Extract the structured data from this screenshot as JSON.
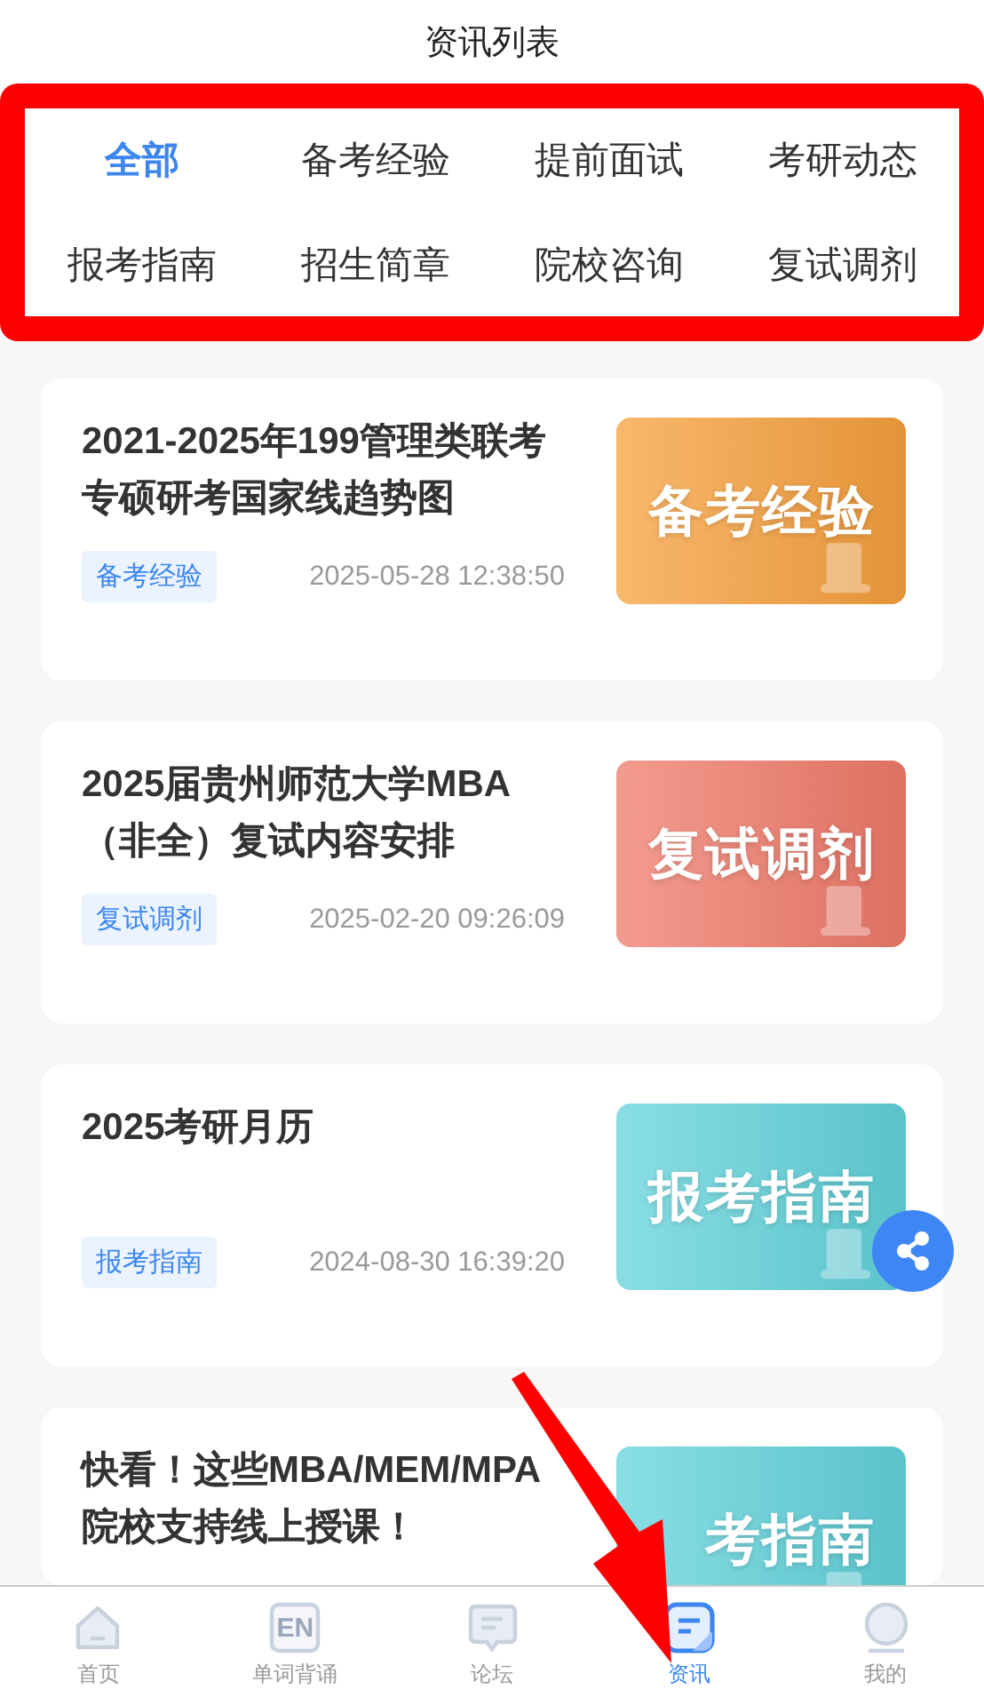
{
  "header": {
    "title": "资讯列表"
  },
  "categories": [
    {
      "label": "全部",
      "selected": true
    },
    {
      "label": "备考经验",
      "selected": false
    },
    {
      "label": "提前面试",
      "selected": false
    },
    {
      "label": "考研动态",
      "selected": false
    },
    {
      "label": "报考指南",
      "selected": false
    },
    {
      "label": "招生简章",
      "selected": false
    },
    {
      "label": "院校咨询",
      "selected": false
    },
    {
      "label": "复试调剂",
      "selected": false
    }
  ],
  "articles": [
    {
      "title": "2021-2025年199管理类联考专硕研考国家线趋势图",
      "tag": "备考经验",
      "date": "2025-05-28 12:38:50",
      "thumbnail": {
        "label": "备考经验",
        "color": "#f7a03c"
      }
    },
    {
      "title": "2025届贵州师范大学MBA（非全）复试内容安排",
      "tag": "复试调剂",
      "date": "2025-02-20 09:26:09",
      "thumbnail": {
        "label": "复试调剂",
        "color": "#f07a6a"
      }
    },
    {
      "title": "2025考研月历",
      "tag": "报考指南",
      "date": "2024-08-30 16:39:20",
      "thumbnail": {
        "label": "报考指南",
        "color": "#62d3dc"
      }
    },
    {
      "title": "快看！这些MBA/MEM/MPA院校支持线上授课！",
      "thumbnail": {
        "label": "考指南",
        "color": "#62d3dc"
      }
    }
  ],
  "bottom_nav": [
    {
      "label": "首页",
      "selected": false
    },
    {
      "label": "单词背诵",
      "selected": false,
      "icon_text": "EN"
    },
    {
      "label": "论坛",
      "selected": false
    },
    {
      "label": "资讯",
      "selected": true
    },
    {
      "label": "我的",
      "selected": false
    }
  ]
}
